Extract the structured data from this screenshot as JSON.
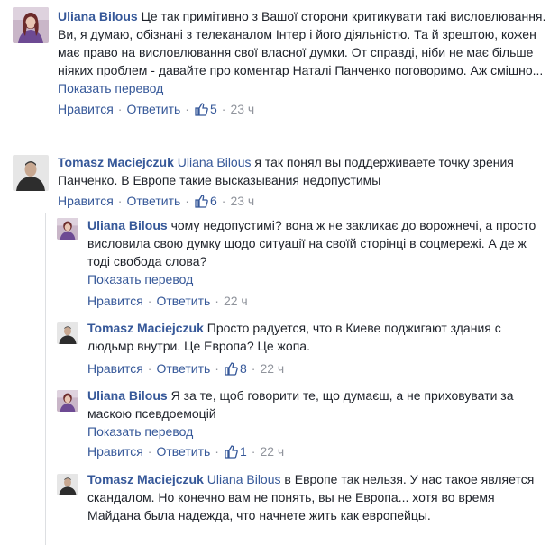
{
  "colors": {
    "link": "#365899",
    "meta": "#90949c",
    "text": "#1d2129"
  },
  "comments": [
    {
      "author": "Uliana Bilous",
      "mention": "",
      "text": "Це так примітивно з Вашої сторони критикувати такі висловлювання. Ви, я думаю, обізнані з телеканалом Інтер і його діяльністю. Та й зрештою, кожен має право на висловлювання свої власної думки. От справді, ніби не має більше ніяких проблем - давайте про коментар Наталі Панченко поговоримо. Аж смішно...",
      "translate": "Показать перевод",
      "like": "Нравится",
      "reply": "Ответить",
      "likes": "5",
      "time": "23 ч"
    },
    {
      "author": "Tomasz Maciejczuk",
      "mention": "Uliana Bilous",
      "text": "я так понял вы поддерживаете точку зрения Панченко. В Европе такие высказывания недопустимы",
      "translate": "",
      "like": "Нравится",
      "reply": "Ответить",
      "likes": "6",
      "time": "23 ч"
    },
    {
      "author": "Uliana Bilous",
      "mention": "",
      "text": "чому недопустимі? вона ж не закликає до ворожнечі, а просто висловила свою думку щодо ситуації на своїй сторінці в соцмережі. А де ж тоді свобода слова?",
      "translate": "Показать перевод",
      "like": "Нравится",
      "reply": "Ответить",
      "likes": "",
      "time": "22 ч"
    },
    {
      "author": "Tomasz Maciejczuk",
      "mention": "",
      "text": "Просто радуется, что в Киеве поджигают здания с людьмр внутри. Це Европа? Це жопа.",
      "translate": "",
      "like": "Нравится",
      "reply": "Ответить",
      "likes": "8",
      "time": "22 ч"
    },
    {
      "author": "Uliana Bilous",
      "mention": "",
      "text": "Я за те, щоб говорити те, що думаєш, а не приховувати за маскою псевдоемоцій",
      "translate": "Показать перевод",
      "like": "Нравится",
      "reply": "Ответить",
      "likes": "1",
      "time": "22 ч"
    },
    {
      "author": "Tomasz Maciejczuk",
      "mention": "Uliana Bilous",
      "text": "в Европе так нельзя. У нас такое является скандалом. Но конечно вам не понять, вы не Европа... хотя во время Майдана была надежда, что начнете жить как европейцы.",
      "translate": "",
      "like": "",
      "reply": "",
      "likes": "",
      "time": ""
    }
  ]
}
